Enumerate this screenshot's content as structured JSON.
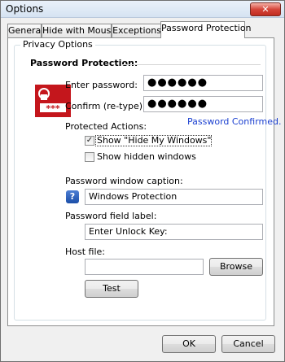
{
  "window": {
    "title": "Options",
    "close_label": "✕"
  },
  "tabs": [
    {
      "label": "General"
    },
    {
      "label": "Hide with Mouse"
    },
    {
      "label": "Exceptions"
    },
    {
      "label": "Password Protection"
    }
  ],
  "panel": {
    "group_title": "Privacy Options",
    "section_title": "Password Protection:",
    "enter_password_label": "Enter password:",
    "enter_password_value": "●●●●●●",
    "confirm_label": "Confirm (re-type):",
    "confirm_value": "●●●●●●",
    "protected_actions_label": "Protected Actions:",
    "status_text": "Password Confirmed.",
    "show_hide_label": "Show \"Hide My Windows\"",
    "show_hide_checked": true,
    "show_hidden_label": "Show hidden windows",
    "show_hidden_checked": false,
    "caption_label": "Password window caption:",
    "caption_value": "Windows Protection",
    "field_label_label": "Password field label:",
    "field_label_value": "Enter Unlock Key:",
    "host_file_label": "Host file:",
    "host_file_value": "",
    "browse_label": "Browse",
    "test_label": "Test",
    "lock_icon_text": "***",
    "help_icon_text": "?",
    "check_mark": "✓"
  },
  "footer": {
    "ok_label": "OK",
    "cancel_label": "Cancel"
  },
  "colors": {
    "status_text": "#1a3fd0",
    "lock_icon": "#c4161c"
  }
}
